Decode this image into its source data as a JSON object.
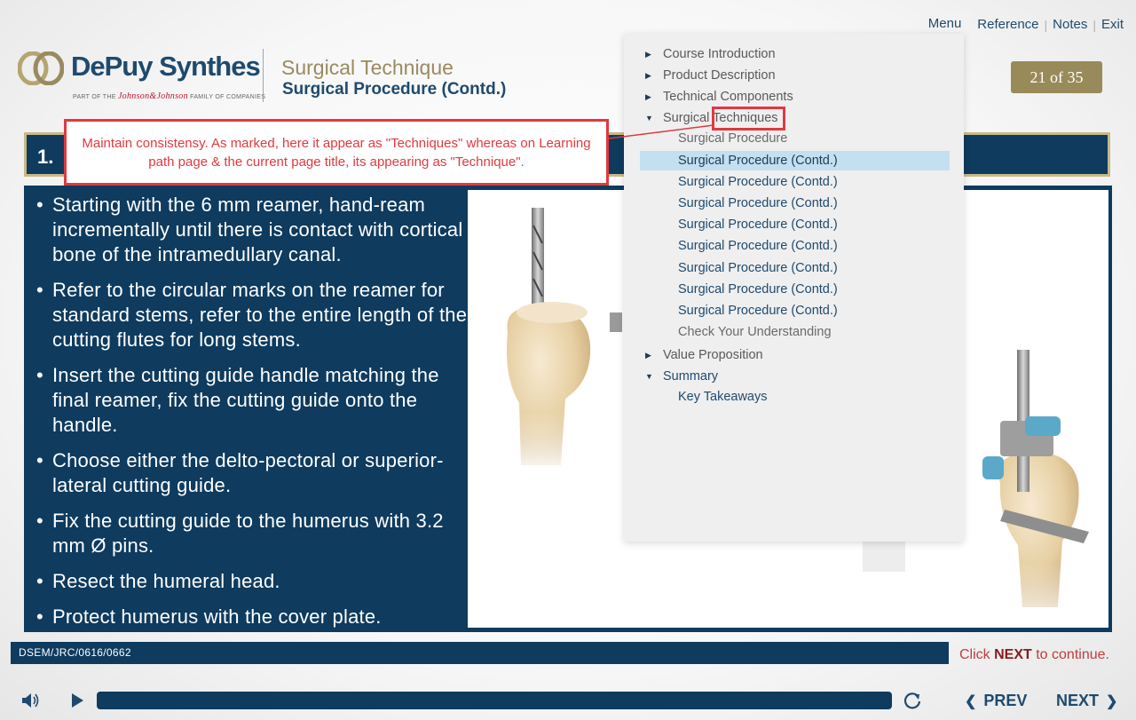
{
  "topnav": {
    "menu": "Menu",
    "reference": "Reference",
    "notes": "Notes",
    "exit": "Exit",
    "sep": "|"
  },
  "logo": {
    "brand": "DePuy Synthes",
    "tagline_pre": "PART OF THE",
    "tagline_jj": "Johnson&Johnson",
    "tagline_post": "FAMILY OF COMPANIES"
  },
  "header": {
    "title": "Surgical Technique",
    "subtitle": "Surgical Procedure (Contd.)"
  },
  "page_counter": "21 of 35",
  "title_bar": {
    "number": "1."
  },
  "bullets": [
    "Starting with the 6 mm reamer, hand-ream incrementally until there is contact with cortical bone of the intramedullary canal.",
    "Refer to the circular marks on the reamer for standard stems, refer to the entire length of the cutting flutes for long stems.",
    "Insert the cutting guide handle matching the final reamer, fix the cutting guide onto the handle.",
    "Choose either the delto-pectoral or superior-lateral cutting guide.",
    "Fix the cutting guide to the humerus with 3.2 mm Ø pins.",
    "Resect the humeral head.",
    "Protect humerus with the cover plate."
  ],
  "menu": {
    "course_intro": "Course Introduction",
    "product_desc": "Product Description",
    "tech_components": "Technical Components",
    "surgical_techniques": "Surgical Techniques",
    "sub_items": [
      "Surgical Procedure",
      "Surgical Procedure (Contd.)",
      "Surgical Procedure (Contd.)",
      "Surgical Procedure (Contd.)",
      "Surgical Procedure (Contd.)",
      "Surgical Procedure (Contd.)",
      "Surgical Procedure (Contd.)",
      "Surgical Procedure (Contd.)",
      "Surgical Procedure (Contd.)",
      "Check Your Understanding"
    ],
    "value_prop": "Value Proposition",
    "summary": "Summary",
    "key_takeaways": "Key Takeaways",
    "active_index": 1
  },
  "annotation": "Maintain consistensy. As marked, here it appear as \"Techniques\" whereas on Learning path page & the current page title, its appearing as \"Technique\".",
  "footer": {
    "code": "DSEM/JRC/0616/0662",
    "click_pre": "Click ",
    "click_next": "NEXT",
    "click_post": " to continue.",
    "prev": "PREV",
    "next": "NEXT"
  },
  "colors": {
    "navy": "#0e3b5e",
    "gold": "#998a59",
    "annotation_red": "#e0393e",
    "active_menu": "#c3dff0"
  },
  "icons": [
    "volume-icon",
    "play-icon",
    "replay-icon",
    "chevron-left-icon",
    "chevron-right-icon",
    "triangle-right-icon",
    "triangle-down-icon"
  ],
  "progress": 1.0
}
